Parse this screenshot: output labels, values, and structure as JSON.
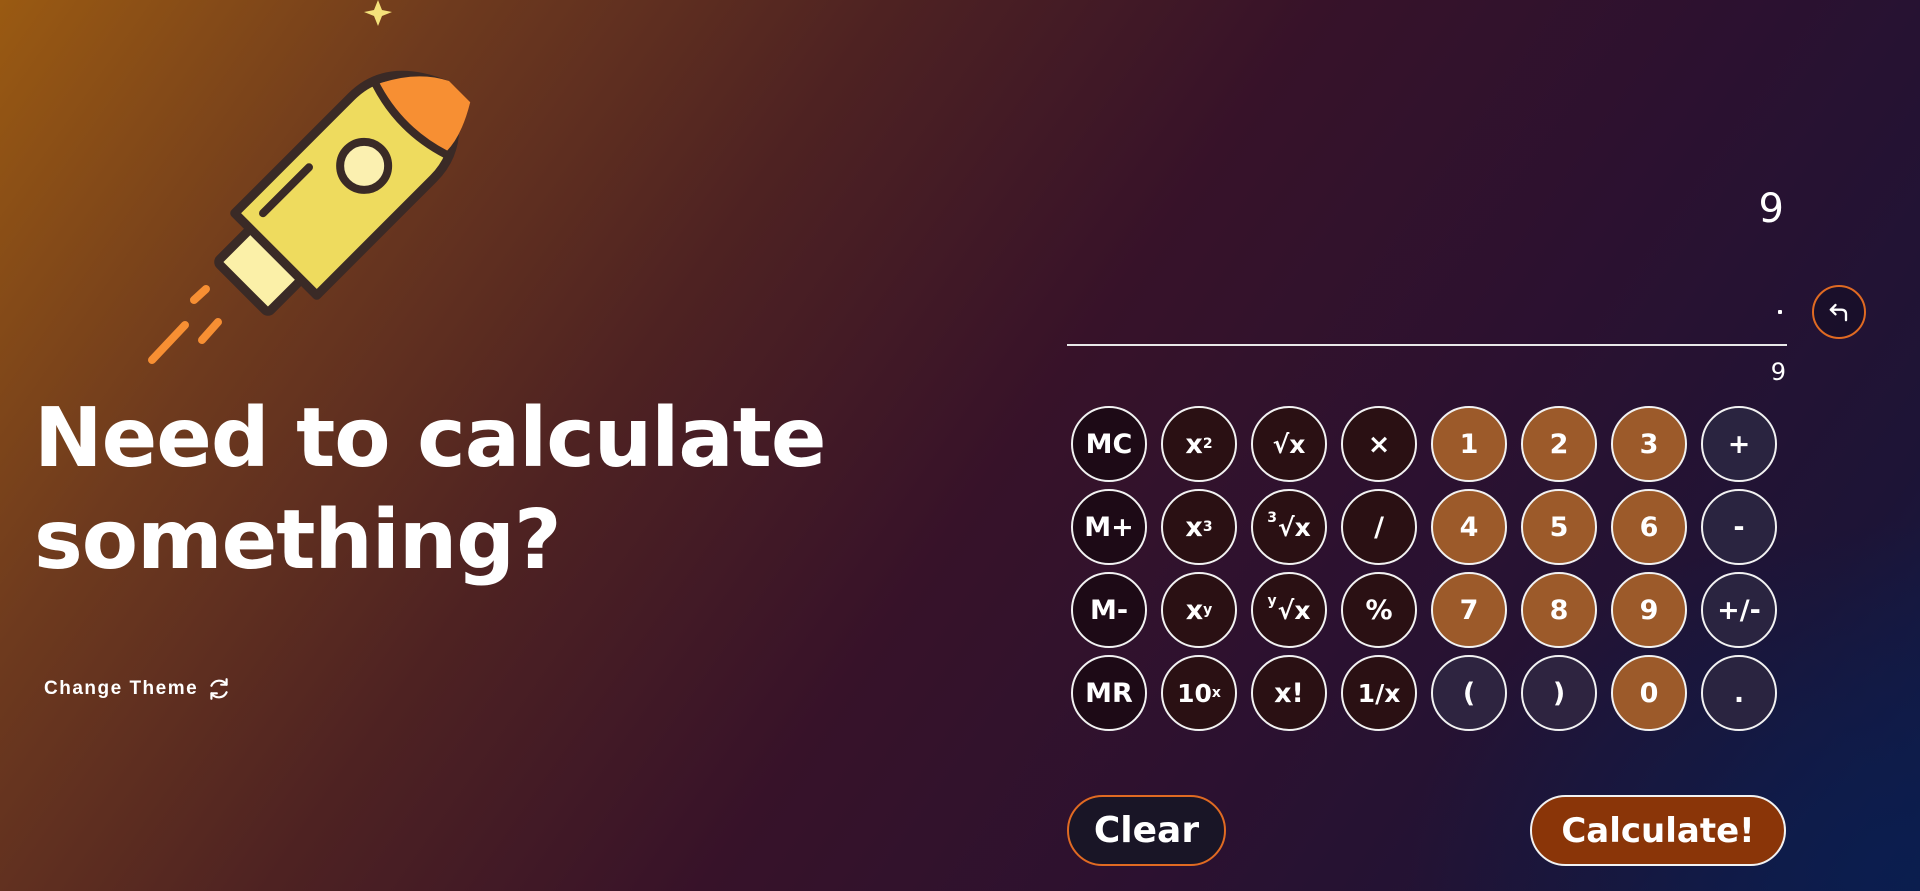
{
  "hero": {
    "line1": "Need to calculate",
    "line2": "something?"
  },
  "theme": {
    "label": "Change Theme",
    "icon": "refresh-icon"
  },
  "display": {
    "expression": "9",
    "result": "9",
    "backspace_icon": "undo-arrow-icon"
  },
  "keypad": {
    "mc": "MC",
    "mplus": "M+",
    "mminus": "M-",
    "mr": "MR",
    "x2_base": "x",
    "x2_exp": "2",
    "x3_base": "x",
    "x3_exp": "3",
    "xy_base": "x",
    "xy_exp": "y",
    "tenx_base": "10",
    "tenx_exp": "x",
    "sqrt": "√x",
    "cbrt_index": "3",
    "cbrt": "√x",
    "yroot_index": "y",
    "yroot": "√x",
    "factorial": "x!",
    "multiply": "×",
    "divide": "/",
    "percent": "%",
    "reciprocal": "1/x",
    "d1": "1",
    "d2": "2",
    "d3": "3",
    "d4": "4",
    "d5": "5",
    "d6": "6",
    "d7": "7",
    "d8": "8",
    "d9": "9",
    "d0": "0",
    "lparen": "(",
    "rparen": ")",
    "plus": "+",
    "minus": "-",
    "negate": "+/-",
    "decimal": "."
  },
  "actions": {
    "clear": "Clear",
    "calculate": "Calculate!"
  },
  "colors": {
    "accent_orange": "#e06a22",
    "digit_key": "#9c5a2a",
    "calculate_bg": "#8a3508",
    "rocket_body": "#eedb5e",
    "rocket_nose": "#f78f33"
  }
}
